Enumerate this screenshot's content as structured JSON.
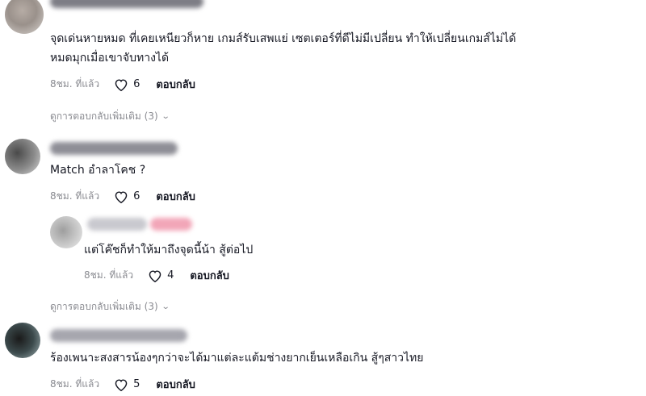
{
  "comments": [
    {
      "text_lines": [
        "จุดเด่นหายหมด ที่เคยเหนียวก็หาย เกมส์รับเสพแย่ เซตเตอร์ที่ดีไม่มีเปลี่ยน ทำให้เปลี่ยนเกมส์ไม่ได้",
        "หมดมุกเมื่อเขาจับทางได้"
      ],
      "time": "8ชม. ที่แล้ว",
      "likes": "6",
      "reply_label": "ตอบกลับ"
    },
    {
      "text": "Match อำลาโคช ?",
      "time": "8ชม. ที่แล้ว",
      "likes": "6",
      "reply_label": "ตอบกลับ"
    },
    {
      "text": "แต่โค๊ชก็ทำให้มาถึงจุดนี้น้า สู้ต่อไป",
      "time": "8ชม. ที่แล้ว",
      "likes": "4",
      "reply_label": "ตอบกลับ"
    },
    {
      "text": "ร้องเพนาะสงสารน้องๆกว่าจะได้มาแต่ละแต้มช่างยากเย็นเหลือเกิน สู้ๆสาวไทย",
      "time": "8ชม. ที่แล้ว",
      "likes": "5",
      "reply_label": "ตอบกลับ"
    }
  ],
  "view_more_replies": [
    "ดูการตอบกลับเพิ่มเติม (3)",
    "ดูการตอบกลับเพิ่มเติม (3)"
  ],
  "icons": {
    "like": "heart-outline-icon",
    "expand": "chevron-down-icon"
  },
  "colors": {
    "text": "#161823",
    "muted": "#8a8b91",
    "background": "#ffffff"
  }
}
